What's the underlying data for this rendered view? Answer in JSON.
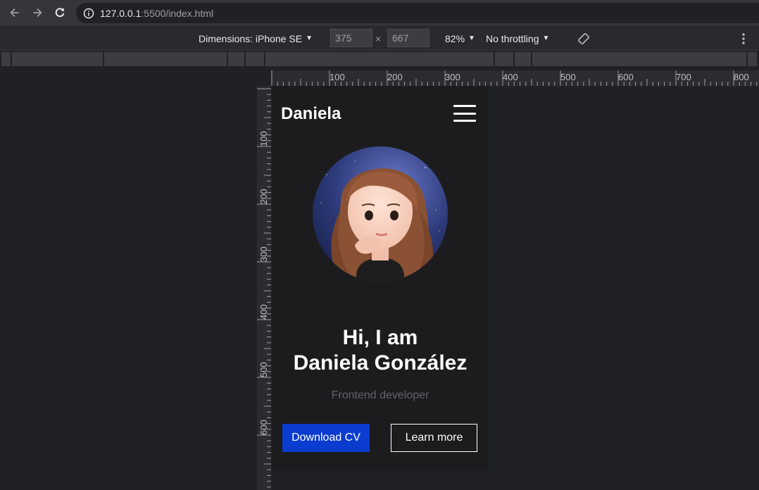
{
  "browser": {
    "url_host": "127.0.0.1",
    "url_path": ":5500/index.html"
  },
  "device_toolbar": {
    "dimensions_label": "Dimensions: iPhone SE",
    "width": "375",
    "times": "×",
    "height": "667",
    "zoom": "82%",
    "throttling": "No throttling"
  },
  "ruler": {
    "top_labels": [
      "100",
      "200",
      "300",
      "400",
      "500",
      "600",
      "700",
      "800"
    ],
    "left_labels": [
      "100",
      "200",
      "300",
      "400",
      "500",
      "600"
    ]
  },
  "page": {
    "brand": "Daniela",
    "hero_line1": "Hi, I am",
    "hero_line2": "Daniela González",
    "subtitle": "Frontend developer",
    "primary_button": "Download CV",
    "secondary_button": "Learn more"
  },
  "colors": {
    "primary_button": "#0a3ccf",
    "page_bg": "#1c1c1e"
  }
}
